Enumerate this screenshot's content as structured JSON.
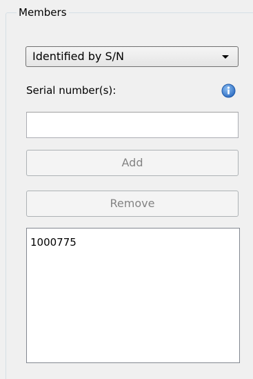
{
  "group": {
    "title": "Members"
  },
  "identify_select": {
    "value": "Identified by S/N"
  },
  "serial": {
    "label": "Serial number(s):",
    "input_value": "",
    "info_icon": "info-icon"
  },
  "buttons": {
    "add_label": "Add",
    "remove_label": "Remove"
  },
  "members_list": {
    "items": [
      "1000775"
    ]
  },
  "colors": {
    "info_icon": "#3b7fd0",
    "disabled_text": "#838383"
  }
}
